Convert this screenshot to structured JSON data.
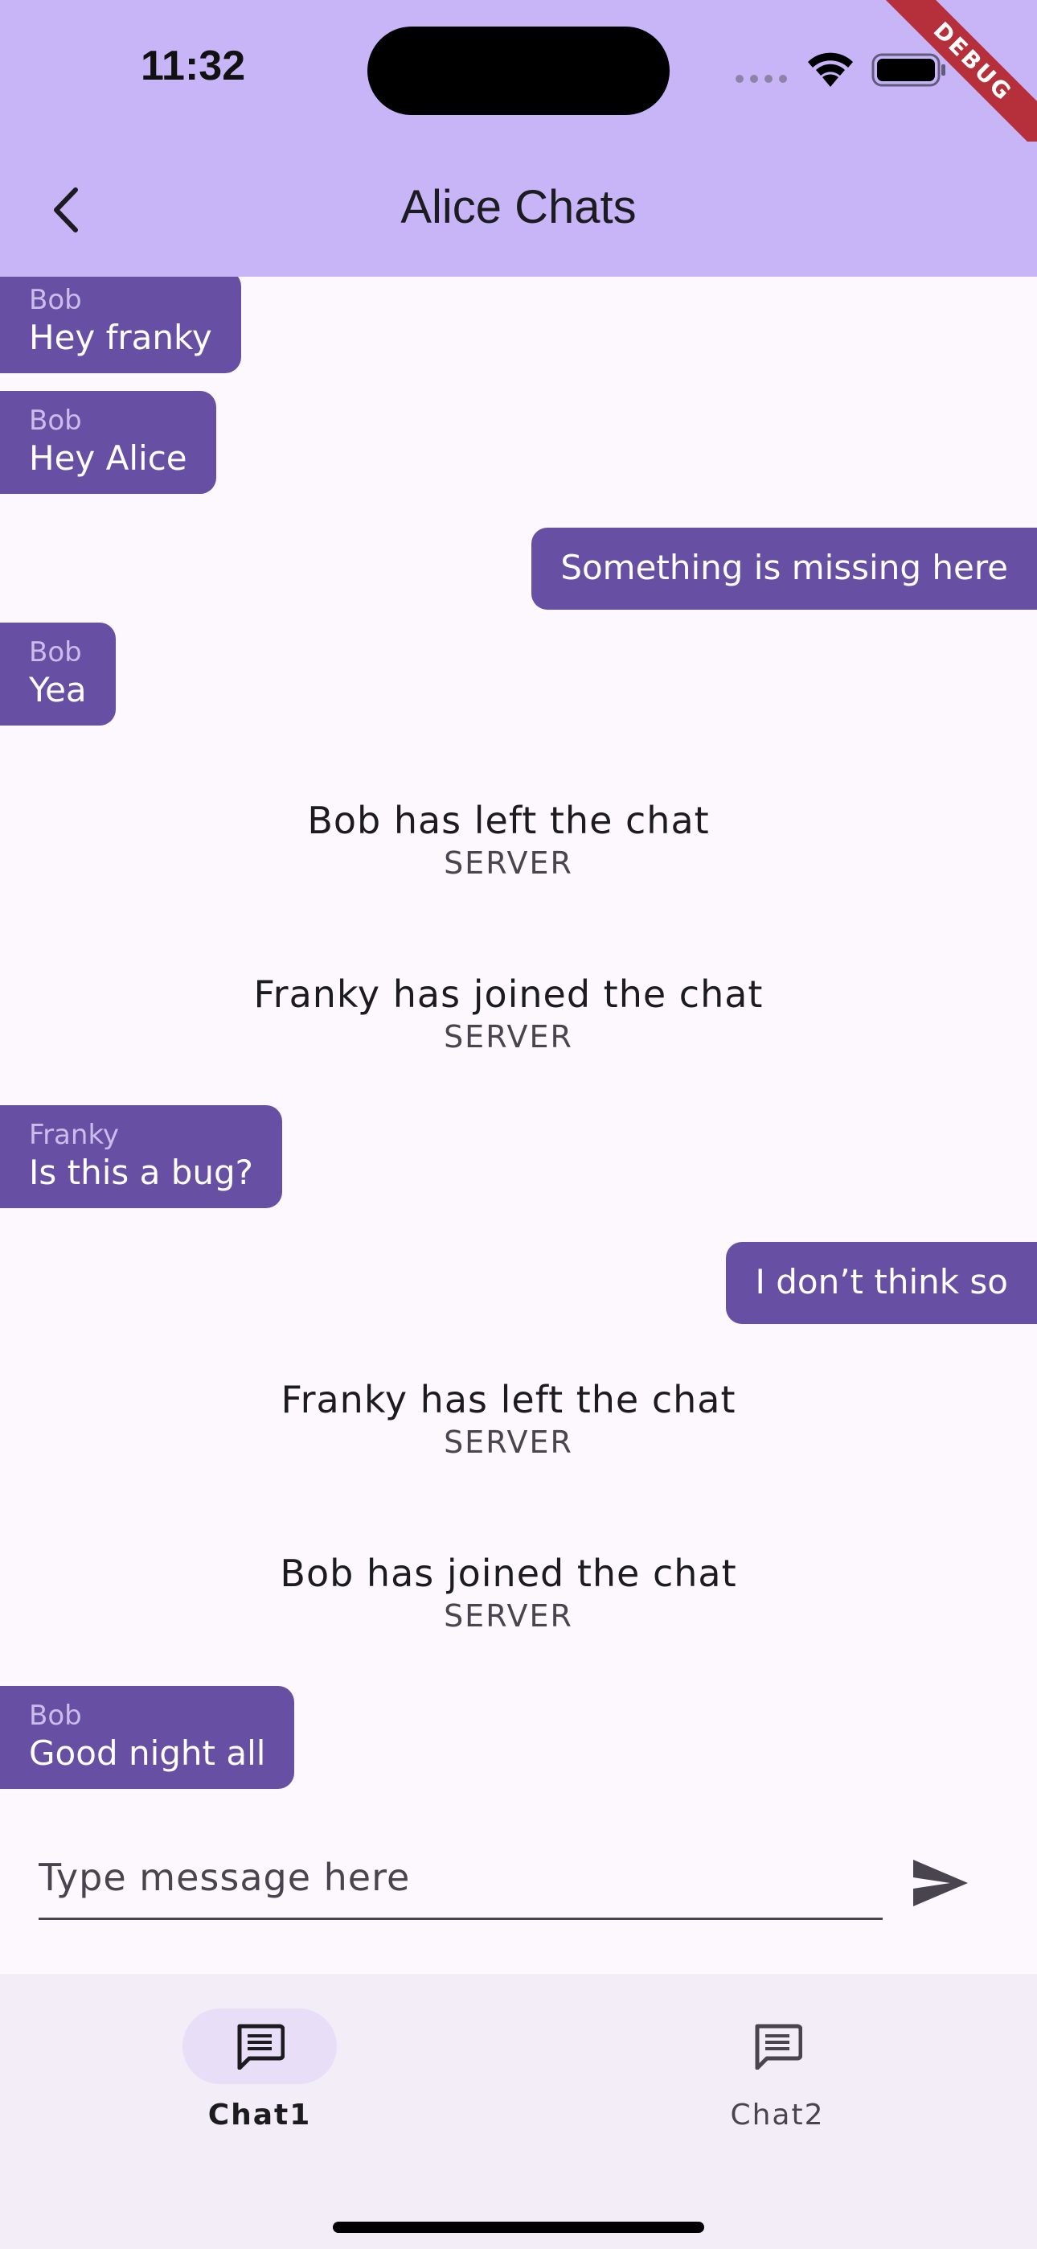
{
  "status_bar": {
    "time": "11:32"
  },
  "debug_banner": "DEBUG",
  "app_bar": {
    "title": "Alice Chats",
    "back_icon": "chevron-left-icon"
  },
  "messages": [
    {
      "type": "incoming",
      "sender": "Bob",
      "text": "Hey franky"
    },
    {
      "type": "incoming",
      "sender": "Bob",
      "text": "Hey Alice"
    },
    {
      "type": "outgoing",
      "text": "Something is missing here"
    },
    {
      "type": "incoming",
      "sender": "Bob",
      "text": "Yea"
    },
    {
      "type": "server",
      "text": "Bob has left the chat",
      "sender": "SERVER"
    },
    {
      "type": "server",
      "text": "Franky has joined the chat",
      "sender": "SERVER"
    },
    {
      "type": "incoming",
      "sender": "Franky",
      "text": "Is this a bug?"
    },
    {
      "type": "outgoing",
      "text": "I don’t think so"
    },
    {
      "type": "server",
      "text": "Franky has left the chat",
      "sender": "SERVER"
    },
    {
      "type": "server",
      "text": "Bob has joined the chat",
      "sender": "SERVER"
    },
    {
      "type": "incoming",
      "sender": "Bob",
      "text": "Good night all"
    }
  ],
  "composer": {
    "placeholder": "Type message here",
    "value": "",
    "send_icon": "send-icon"
  },
  "bottom_nav": [
    {
      "label": "Chat1",
      "icon": "chat-icon",
      "active": true
    },
    {
      "label": "Chat2",
      "icon": "chat-icon",
      "active": false
    }
  ],
  "colors": {
    "app_bar": "#C7B5F8",
    "bubble": "#6750A4",
    "background": "#FDF7FE",
    "nav_background": "#F2EDF6",
    "nav_active_pill": "#E8DEF8"
  }
}
